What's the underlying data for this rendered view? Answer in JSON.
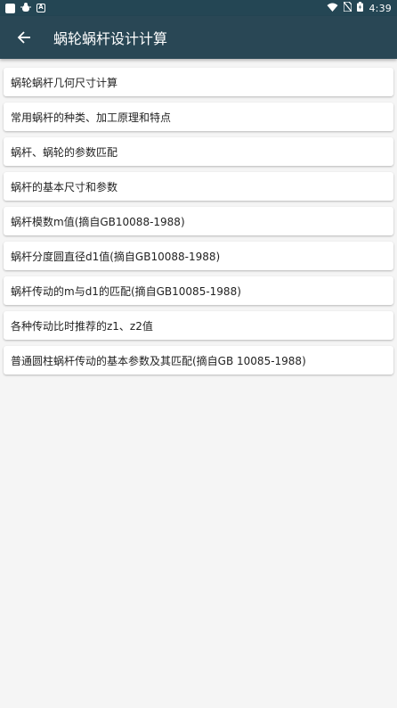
{
  "status_bar": {
    "time": "4:39",
    "icons": [
      "square-notification-icon",
      "bug-icon",
      "a-icon",
      "wifi-icon",
      "no-sim-icon",
      "battery-icon"
    ]
  },
  "app_bar": {
    "title": "蜗轮蜗杆设计计算",
    "back_icon": "arrow-left-icon"
  },
  "colors": {
    "status_bar": "#244654",
    "app_bar": "#294755",
    "background": "#f5f5f5",
    "card": "#ffffff"
  },
  "items": [
    {
      "label": "蜗轮蜗杆几何尺寸计算"
    },
    {
      "label": "常用蜗杆的种类、加工原理和特点"
    },
    {
      "label": "蜗杆、蜗轮的参数匹配"
    },
    {
      "label": "蜗杆的基本尺寸和参数"
    },
    {
      "label": "蜗杆模数m值(摘自GB10088-1988)"
    },
    {
      "label": "蜗杆分度圆直径d1值(摘自GB10088-1988)"
    },
    {
      "label": "蜗杆传动的m与d1的匹配(摘自GB10085-1988)"
    },
    {
      "label": "各种传动比时推荐的z1、z2值"
    },
    {
      "label": "普通圆柱蜗杆传动的基本参数及其匹配(摘自GB 10085-1988)"
    }
  ]
}
